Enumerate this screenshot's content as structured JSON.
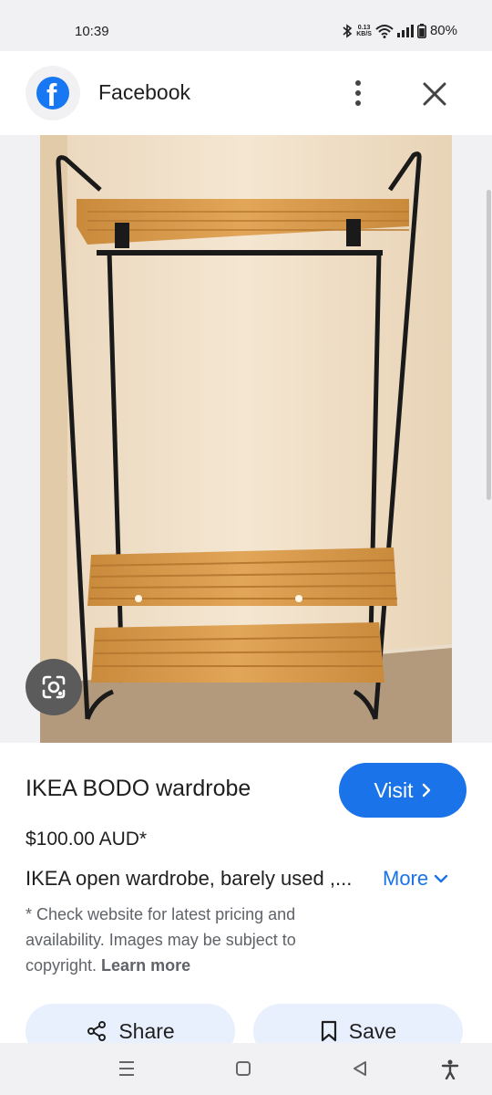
{
  "status_bar": {
    "time": "10:39",
    "speed_top": "0.13",
    "speed_bottom": "KB/S",
    "battery": "80%"
  },
  "header": {
    "site_name": "Facebook",
    "logo_letter": "f"
  },
  "product": {
    "title": "IKEA BODO wardrobe",
    "visit_label": "Visit",
    "price": "$100.00 AUD*",
    "description": "IKEA open wardrobe, barely used ,...",
    "more_label": "More",
    "disclaimer": "* Check website for latest pricing and availability. Images may be subject to copyright. ",
    "learn_more_label": "Learn more"
  },
  "actions": {
    "share_label": "Share",
    "save_label": "Save"
  },
  "colors": {
    "accent": "#1a73e8",
    "facebook_blue": "#1877f2",
    "chip_bg": "#e8f0fe"
  }
}
